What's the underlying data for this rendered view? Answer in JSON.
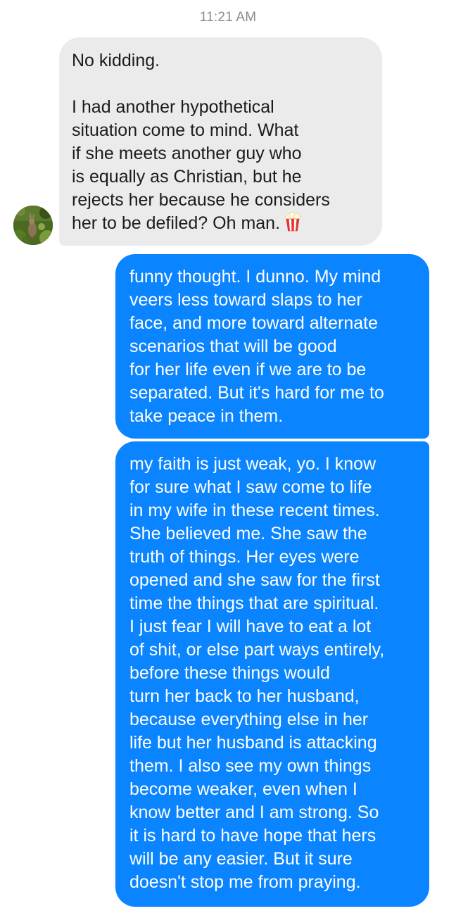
{
  "header": {
    "timestamp": "11:21 AM"
  },
  "messages": [
    {
      "sender": "them",
      "text": "No kidding.\n\nI had another hypothetical\nsituation come to mind. What\nif she meets another guy who\nis equally as Christian, but he\nrejects her because he considers\nher to be defiled? Oh man.",
      "emoji": "popcorn-icon"
    },
    {
      "sender": "me",
      "text": "funny thought. I dunno. My mind\nveers less toward slaps to her\nface, and more toward alternate\nscenarios that will be good\nfor her life even if we are to be\nseparated. But it's hard for me to\ntake peace in them."
    },
    {
      "sender": "me",
      "text": "my faith is just weak, yo. I know\nfor sure what I saw come to life\nin my wife in these recent times.\nShe believed me. She saw the\ntruth of things. Her eyes were\nopened and she saw for the first\ntime the things that are spiritual.\nI just fear I will have to eat a lot\nof shit, or else part ways entirely,\nbefore these things would\nturn her back to her husband,\nbecause everything else in her\nlife but her husband is attacking\nthem. I also see my own things\nbecome weaker, even when I\nknow better and I am strong. So\nit is hard to have hope that hers\nwill be any easier. But it sure\ndoesn't stop me from praying."
    }
  ],
  "colors": {
    "incoming_bubble": "#ebebeb",
    "outgoing_bubble": "#0a84ff",
    "timestamp": "#8a8a8a"
  }
}
